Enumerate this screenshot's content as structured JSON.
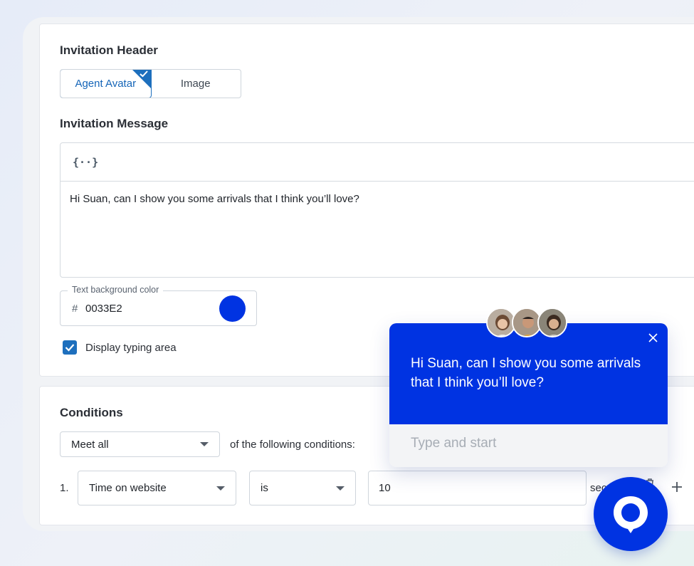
{
  "header_section": {
    "title": "Invitation Header",
    "options": [
      {
        "label": "Agent Avatar",
        "selected": true
      },
      {
        "label": "Image",
        "selected": false
      }
    ]
  },
  "message_section": {
    "title": "Invitation Message",
    "toolbar_icon": "variable-braces-icon",
    "toolbar_glyph": "{··}",
    "text": "Hi Suan, can I show you some arrivals that I think you’ll love?"
  },
  "color_field": {
    "legend": "Text background color",
    "hash": "#",
    "value": "0033E2",
    "swatch_color": "#0033e2"
  },
  "typing_area": {
    "label": "Display typing area",
    "checked": true
  },
  "conditions": {
    "title": "Conditions",
    "match_select": "Meet all",
    "match_suffix": "of the following conditions:",
    "rows": [
      {
        "index": "1.",
        "field": "Time on website",
        "operator": "is",
        "value": "10",
        "unit": "sec"
      }
    ]
  },
  "widget": {
    "message": "Hi Suan, can I show you some arrivals that I think you’ll love?",
    "placeholder": "Type and start",
    "brand_color": "#0033e2"
  },
  "accent_color": "#1d6fbd"
}
